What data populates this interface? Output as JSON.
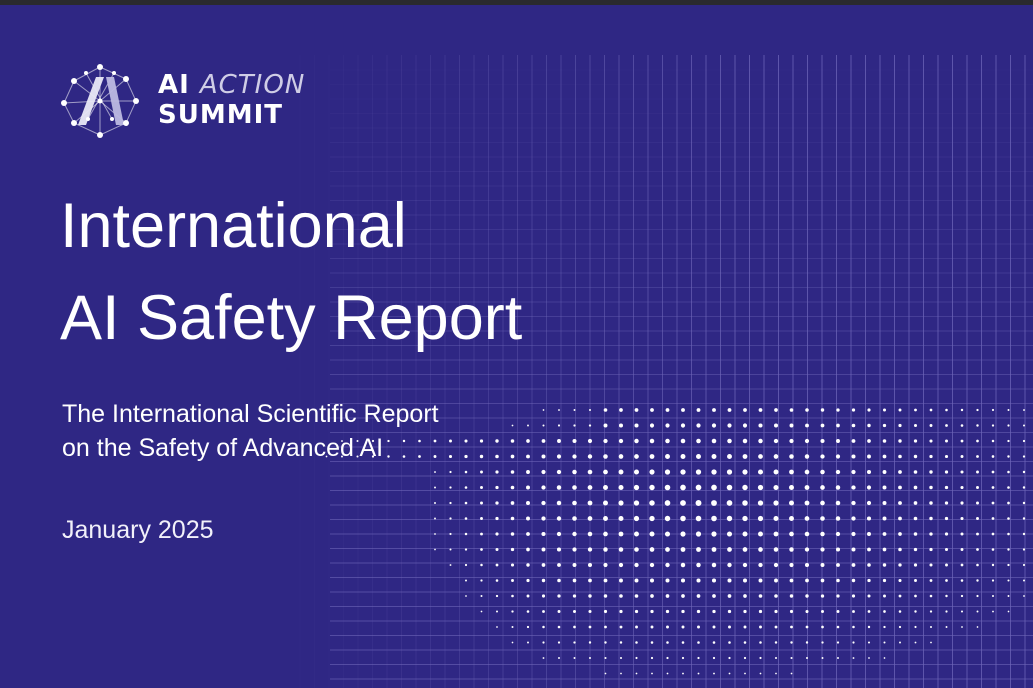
{
  "brand": {
    "line1_ai": "AI",
    "line1_action": "ACTION",
    "line2": "SUMMIT",
    "logo_icon": "ai-network-icon"
  },
  "report": {
    "title_line1": "International",
    "title_line2": "AI Safety Report",
    "subtitle_line1": "The International Scientific Report",
    "subtitle_line2": "on the Safety of Advanced AI",
    "date": "January 2025"
  },
  "colors": {
    "background": "#2f2784",
    "grid_line": "#6e66b8",
    "dot": "#ffffff",
    "accent_text": "#cfcde6"
  }
}
